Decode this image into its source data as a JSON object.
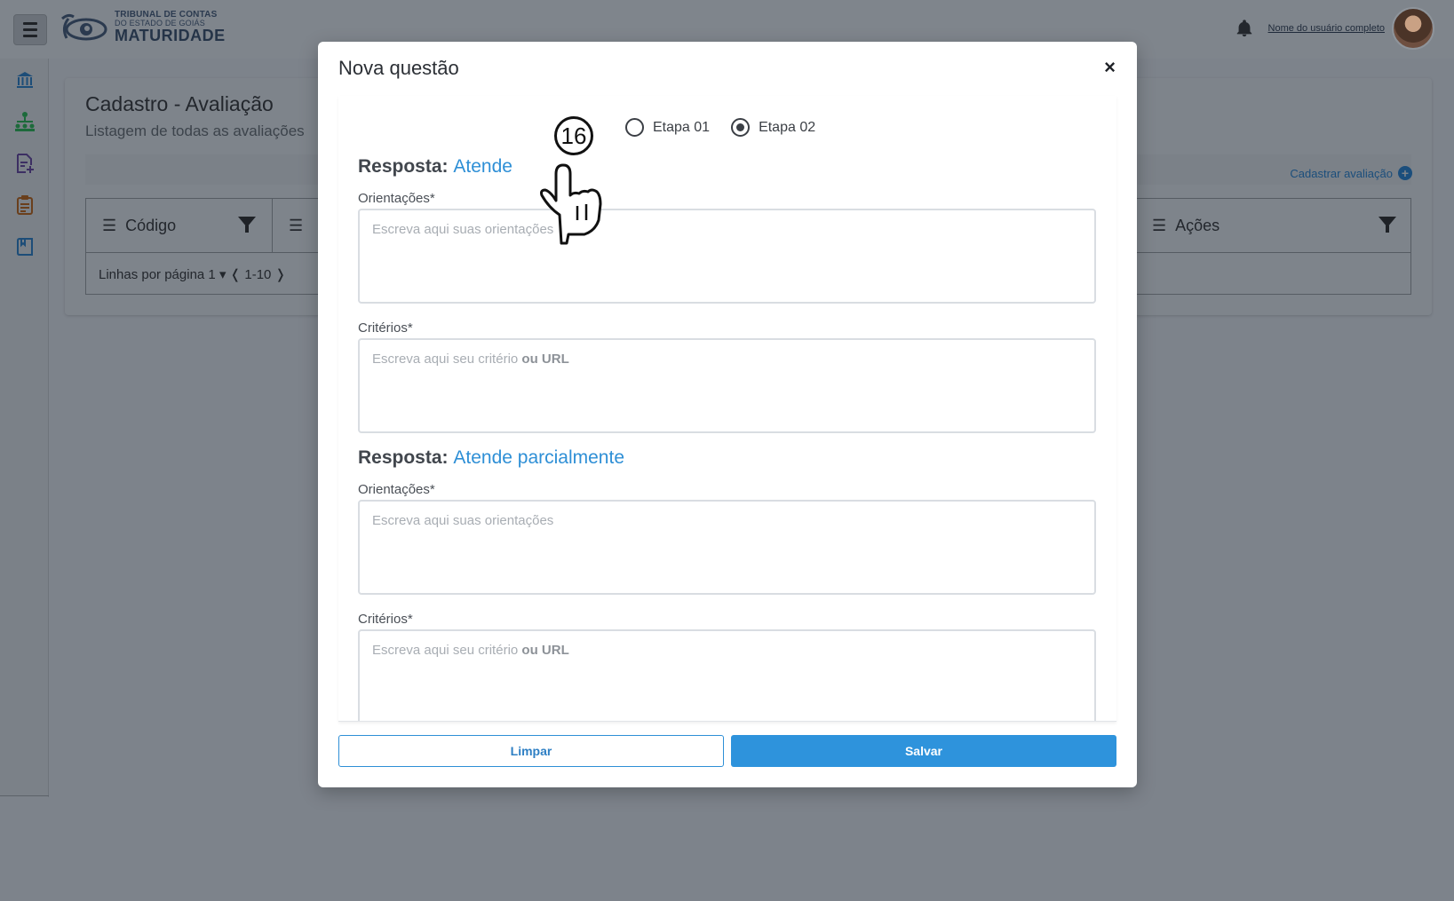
{
  "header": {
    "logo_line1": "TRIBUNAL DE CONTAS",
    "logo_line2": "DO ESTADO DE GOIÁS",
    "logo_line3": "MATURIDADE",
    "user_name": "Nome do usuário completo"
  },
  "sidebar": {
    "icons": [
      "institution-icon",
      "org-chart-icon",
      "add-document-icon",
      "clipboard-icon",
      "notebook-icon"
    ]
  },
  "page": {
    "title": "Cadastro -  Avaliação",
    "subtitle": "Listagem de todas as avaliações",
    "add_link": "Cadastrar avaliação",
    "columns": [
      "Código",
      "",
      "",
      "Ações"
    ],
    "pagination": "Linhas por  página  1 ▾ ❬ 1-10 ❭"
  },
  "modal": {
    "title": "Nova questão",
    "close": "×",
    "stage_options": [
      {
        "label": "Etapa 01",
        "selected": false
      },
      {
        "label": "Etapa 02",
        "selected": true
      }
    ],
    "section1": {
      "prefix": "Resposta:",
      "value": "Atende",
      "orientacoes_label": "Orientações*",
      "orientacoes_placeholder": "Escreva aqui suas orientações",
      "criterios_label": "Critérios*",
      "criterios_placeholder": "Escreva aqui seu  critério",
      "criterios_placeholder_bold": "ou URL"
    },
    "section2": {
      "prefix": "Resposta:",
      "value": "Atende parcialmente",
      "orientacoes_label": "Orientações*",
      "orientacoes_placeholder": "Escreva aqui suas orientações",
      "criterios_label": "Critérios*",
      "criterios_placeholder": "Escreva aqui seu  critério",
      "criterios_placeholder_bold": "ou URL"
    },
    "buttons": {
      "clear": "Limpar",
      "save": "Salvar"
    }
  },
  "annotation": {
    "step": "16"
  },
  "colors": {
    "accent": "#2e93dc",
    "overlay": "#7d838b"
  }
}
